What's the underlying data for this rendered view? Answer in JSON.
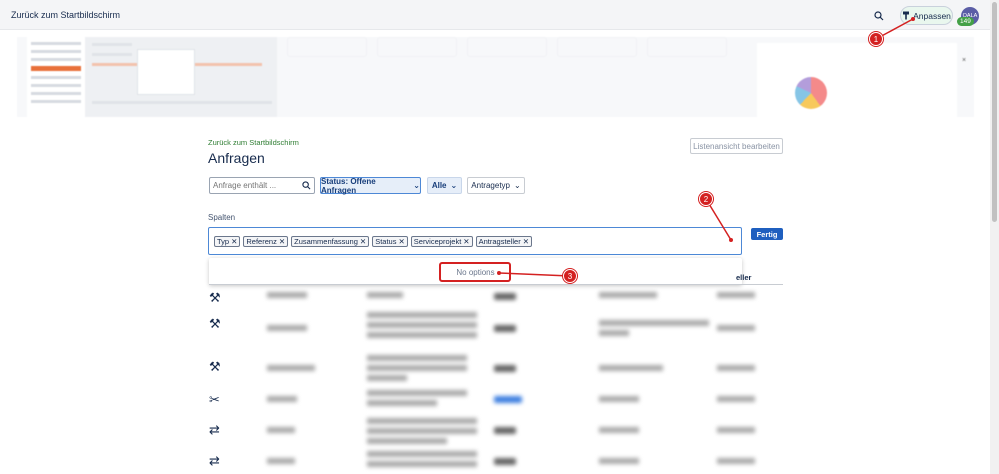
{
  "topbar": {
    "back_label": "Zurück zum Startbildschirm",
    "customize_label": "Anpassen",
    "avatar_initials": "OALA",
    "notification_count": "149"
  },
  "header": {
    "breadcrumb": "Zurück zum Startbildschirm",
    "title": "Anfragen",
    "edit_list_label": "Listenansicht bearbeiten"
  },
  "filters": {
    "search_placeholder": "Anfrage enthält ...",
    "status_label": "Status: Offene Anfragen",
    "all_label": "Alle",
    "type_label": "Antragetyp"
  },
  "columns": {
    "label": "Spalten",
    "chips": [
      "Typ",
      "Referenz",
      "Zusammenfassung",
      "Status",
      "Serviceprojekt",
      "Antragsteller"
    ],
    "done_label": "Fertig",
    "no_options": "No options"
  },
  "table": {
    "visible_header": "eller"
  },
  "annotations": [
    "1",
    "2",
    "3"
  ],
  "colors": {
    "accent": "#1f5fbf",
    "annotation": "#d42121",
    "breadcrumb": "#2e7d32"
  }
}
